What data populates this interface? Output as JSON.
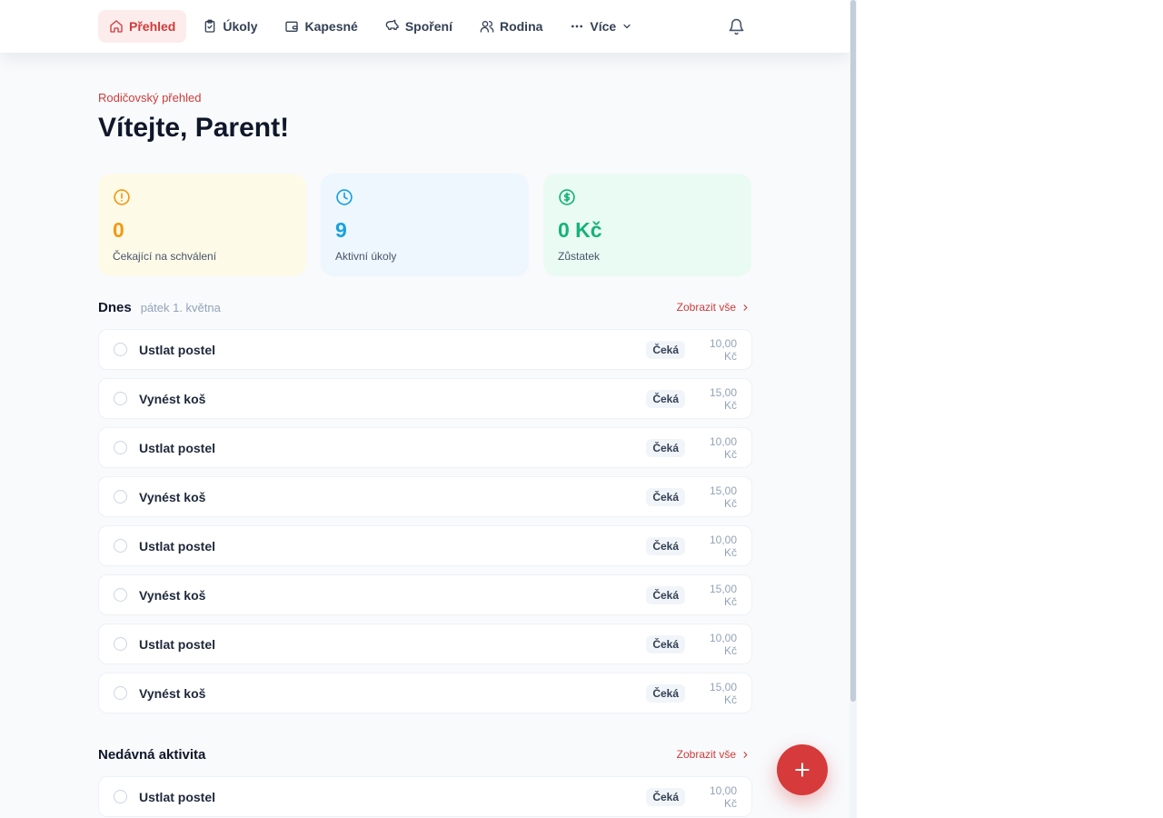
{
  "nav": {
    "items": [
      {
        "label": "Přehled",
        "icon": "home-icon",
        "active": true
      },
      {
        "label": "Úkoly",
        "icon": "clipboard-icon",
        "active": false
      },
      {
        "label": "Kapesné",
        "icon": "wallet-icon",
        "active": false
      },
      {
        "label": "Spoření",
        "icon": "piggy-bank-icon",
        "active": false
      },
      {
        "label": "Rodina",
        "icon": "users-icon",
        "active": false
      },
      {
        "label": "Více",
        "icon": "more-dots-icon",
        "active": false
      }
    ],
    "notifications_icon": "bell-icon"
  },
  "header": {
    "eyebrow": "Rodičovský přehled",
    "title": "Vítejte, Parent!"
  },
  "stats": [
    {
      "value": "0",
      "label": "Čekající na schválení",
      "icon": "alert-circle-icon",
      "color": "#f29a12"
    },
    {
      "value": "9",
      "label": "Aktivní úkoly",
      "icon": "clock-icon",
      "color": "#16a2de"
    },
    {
      "value": "0 Kč",
      "label": "Zůstatek",
      "icon": "dollar-circle-icon",
      "color": "#16b37a"
    }
  ],
  "today": {
    "title": "Dnes",
    "date": "pátek 1. května",
    "show_all": "Zobrazit vše",
    "tasks": [
      {
        "name": "Ustlat postel",
        "status": "Čeká",
        "amount": "10,00 Kč"
      },
      {
        "name": "Vynést koš",
        "status": "Čeká",
        "amount": "15,00 Kč"
      },
      {
        "name": "Ustlat postel",
        "status": "Čeká",
        "amount": "10,00 Kč"
      },
      {
        "name": "Vynést koš",
        "status": "Čeká",
        "amount": "15,00 Kč"
      },
      {
        "name": "Ustlat postel",
        "status": "Čeká",
        "amount": "10,00 Kč"
      },
      {
        "name": "Vynést koš",
        "status": "Čeká",
        "amount": "15,00 Kč"
      },
      {
        "name": "Ustlat postel",
        "status": "Čeká",
        "amount": "10,00 Kč"
      },
      {
        "name": "Vynést koš",
        "status": "Čeká",
        "amount": "15,00 Kč"
      }
    ]
  },
  "recent": {
    "title": "Nedávná aktivita",
    "show_all": "Zobrazit vše",
    "tasks": [
      {
        "name": "Ustlat postel",
        "status": "Čeká",
        "amount": "10,00 Kč"
      }
    ]
  },
  "fab": {
    "icon": "plus-icon"
  },
  "colors": {
    "accent": "#d03a3a",
    "page_bg": "#f8fafc"
  }
}
